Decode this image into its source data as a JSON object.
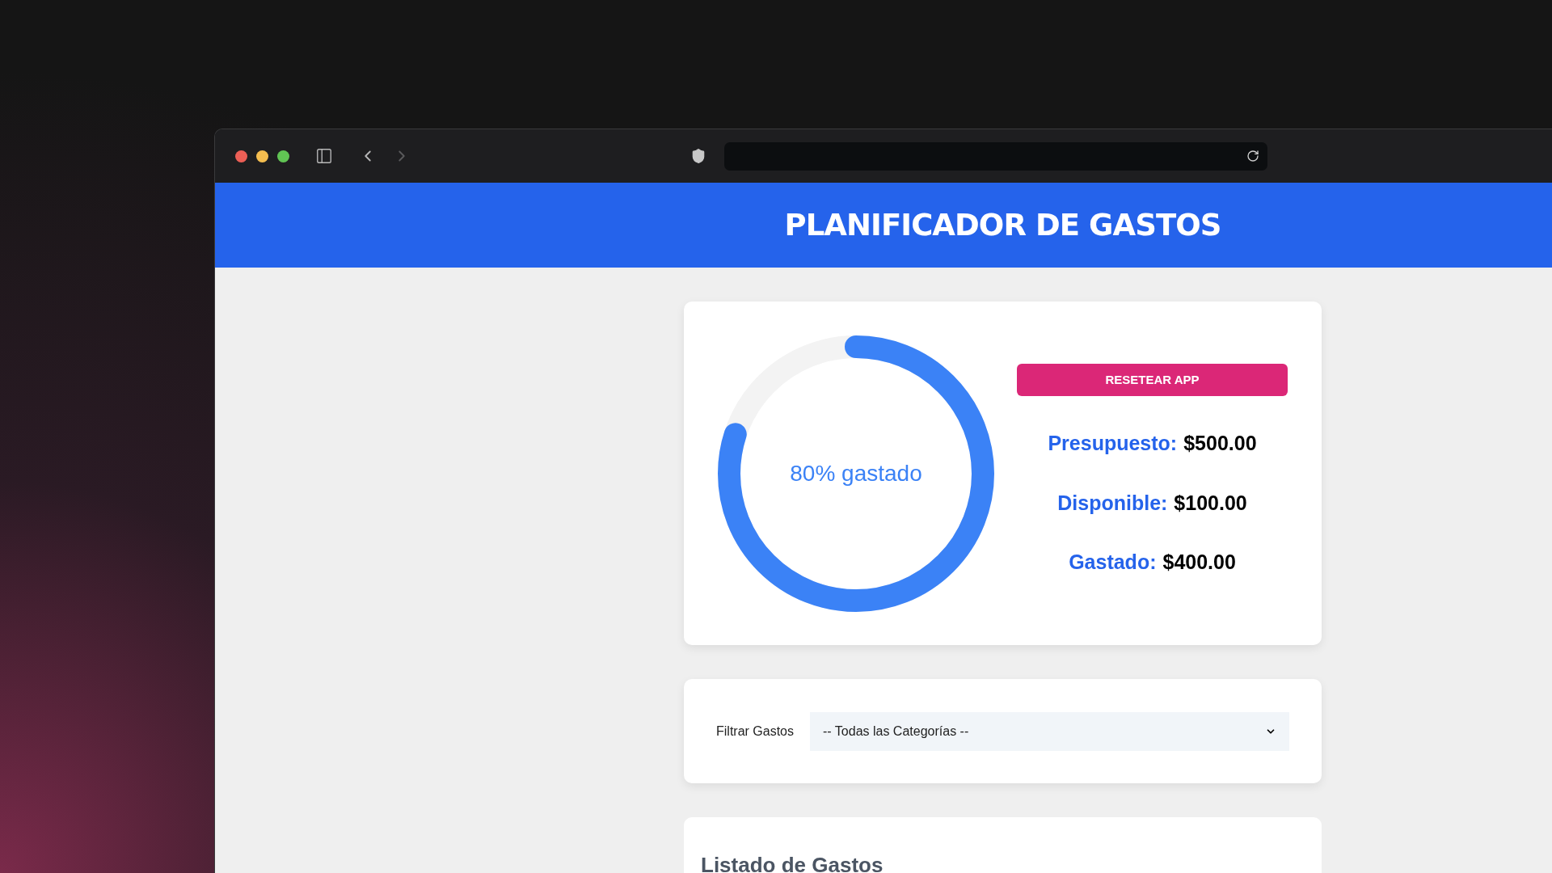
{
  "header": {
    "title": "PLANIFICADOR DE GASTOS"
  },
  "budget": {
    "progress": {
      "level": 0.8,
      "label": "80% gastado"
    },
    "reset_button": "RESETEAR APP",
    "stats": [
      {
        "label": "Presupuesto:",
        "value": "$500.00"
      },
      {
        "label": "Disponible:",
        "value": "$100.00"
      },
      {
        "label": "Gastado:",
        "value": "$400.00"
      }
    ]
  },
  "filter": {
    "label": "Filtrar Gastos",
    "value": "-- Todas las Categorías --"
  },
  "expenses": {
    "title": "Listado de Gastos"
  }
}
